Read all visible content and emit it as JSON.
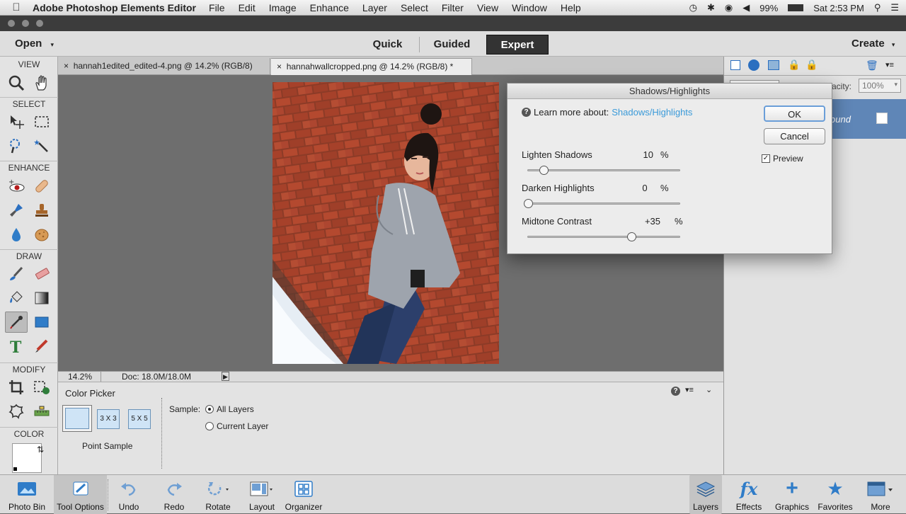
{
  "menubar": {
    "app_name": "Adobe Photoshop Elements Editor",
    "items": [
      "File",
      "Edit",
      "Image",
      "Enhance",
      "Layer",
      "Select",
      "Filter",
      "View",
      "Window",
      "Help"
    ],
    "battery": "99%",
    "clock": "Sat 2:53 PM"
  },
  "modebar": {
    "open_label": "Open",
    "modes": [
      "Quick",
      "Guided",
      "Expert"
    ],
    "active_mode": "Expert",
    "create_label": "Create"
  },
  "toolbox": {
    "sections": [
      "VIEW",
      "SELECT",
      "ENHANCE",
      "DRAW",
      "MODIFY",
      "COLOR"
    ]
  },
  "tabs": [
    {
      "title": "hannah1edited_edited-4.png @ 14.2% (RGB/8)"
    },
    {
      "title": "hannahwallcropped.png @ 14.2% (RGB/8) *"
    }
  ],
  "status": {
    "zoom": "14.2%",
    "doc": "Doc: 18.0M/18.0M"
  },
  "tool_options": {
    "title": "Color Picker",
    "sizes": [
      "3 X 3",
      "5 X 5"
    ],
    "point_sample": "Point Sample",
    "sample_label": "Sample:",
    "sample_options": [
      "All Layers",
      "Current Layer"
    ],
    "sample_selected": "All Layers"
  },
  "layers_panel": {
    "opacity_label": "acity:",
    "opacity_value": "100%",
    "layer_name_partial": "ound"
  },
  "dialog": {
    "title": "Shadows/Highlights",
    "learn_prefix": "Learn more about:",
    "learn_link": "Shadows/Highlights",
    "ok": "OK",
    "cancel": "Cancel",
    "preview_label": "Preview",
    "preview_checked": true,
    "sliders": [
      {
        "label": "Lighten Shadows",
        "value": "10",
        "unit": "%",
        "fraction": 0.1
      },
      {
        "label": "Darken Highlights",
        "value": "0",
        "unit": "%",
        "fraction": 0.0
      },
      {
        "label": "Midtone Contrast",
        "value": "+35",
        "unit": "%",
        "fraction": 0.675
      }
    ]
  },
  "bottombar": {
    "left": [
      "Photo Bin",
      "Tool Options",
      "Undo",
      "Redo",
      "Rotate",
      "Layout",
      "Organizer"
    ],
    "right": [
      "Layers",
      "Effects",
      "Graphics",
      "Favorites",
      "More"
    ]
  },
  "colors": {
    "accent_link": "#3a9ad9",
    "brick": "#a8442c"
  }
}
